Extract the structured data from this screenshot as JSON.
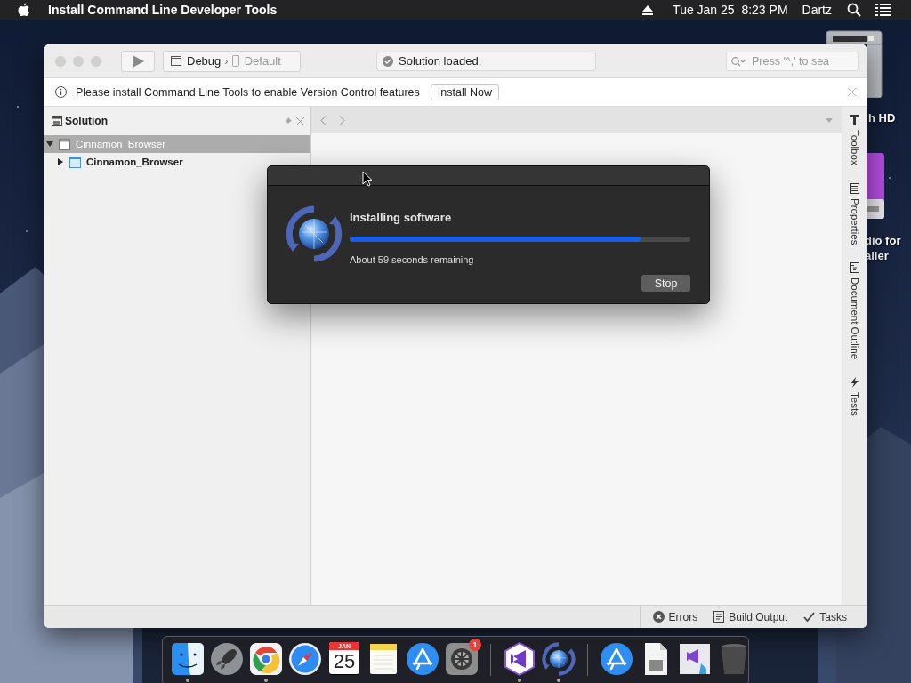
{
  "menu_bar": {
    "app_title": "Install Command Line Developer Tools",
    "clock": "Tue Jan 25  8:23 PM",
    "user": "Dartz"
  },
  "desktop": {
    "icons": [
      {
        "kind": "disk",
        "label_lines": [
          "h HD"
        ]
      },
      {
        "kind": "installer",
        "label_lines": [
          "dio for",
          "aller"
        ]
      }
    ]
  },
  "ide": {
    "toolbar": {
      "configuration": "Debug",
      "separator": "›",
      "device": "Default",
      "status": "Solution loaded.",
      "search_placeholder": "Press '^,' to sea"
    },
    "info_bar": {
      "message": "Please install Command Line Tools to enable Version Control features",
      "button": "Install Now"
    },
    "solution_pad": {
      "title": "Solution",
      "tree": [
        {
          "kind": "solution",
          "label": "Cinnamon_Browser",
          "selected": true,
          "expanded": true,
          "startup": false,
          "children": [
            {
              "kind": "project",
              "label": "Cinnamon_Browser",
              "selected": false,
              "expanded": false,
              "startup": true
            }
          ]
        }
      ]
    },
    "side_tabs": [
      {
        "kind": "toolbox",
        "label": "Toolbox"
      },
      {
        "kind": "properties",
        "label": "Properties"
      },
      {
        "kind": "outline",
        "label": "Document Outline"
      },
      {
        "kind": "tests",
        "label": "Tests"
      }
    ],
    "status_tabs": [
      {
        "kind": "errors",
        "label": "Errors"
      },
      {
        "kind": "build",
        "label": "Build Output"
      },
      {
        "kind": "tasks",
        "label": "Tasks"
      }
    ]
  },
  "dialog": {
    "title": "Installing software",
    "progress": {
      "level": 0.855
    },
    "remaining": "About 59 seconds remaining",
    "button": "Stop"
  },
  "dock": {
    "items": [
      {
        "kind": "finder",
        "running": true
      },
      {
        "kind": "launchpad",
        "running": false
      },
      {
        "kind": "chrome",
        "running": true
      },
      {
        "kind": "safari",
        "running": false
      },
      {
        "kind": "calendar",
        "running": false,
        "month": "JAN",
        "day": "25"
      },
      {
        "kind": "notes",
        "running": false
      },
      {
        "kind": "appstore",
        "running": false
      },
      {
        "kind": "settings",
        "running": false,
        "badge": "1"
      },
      {
        "kind": "separator"
      },
      {
        "kind": "vs",
        "running": true
      },
      {
        "kind": "installer",
        "running": true
      },
      {
        "kind": "separator"
      },
      {
        "kind": "downloads",
        "running": false
      },
      {
        "kind": "document",
        "running": false
      },
      {
        "kind": "vsinstaller",
        "running": false
      },
      {
        "kind": "trash",
        "running": false
      }
    ]
  }
}
